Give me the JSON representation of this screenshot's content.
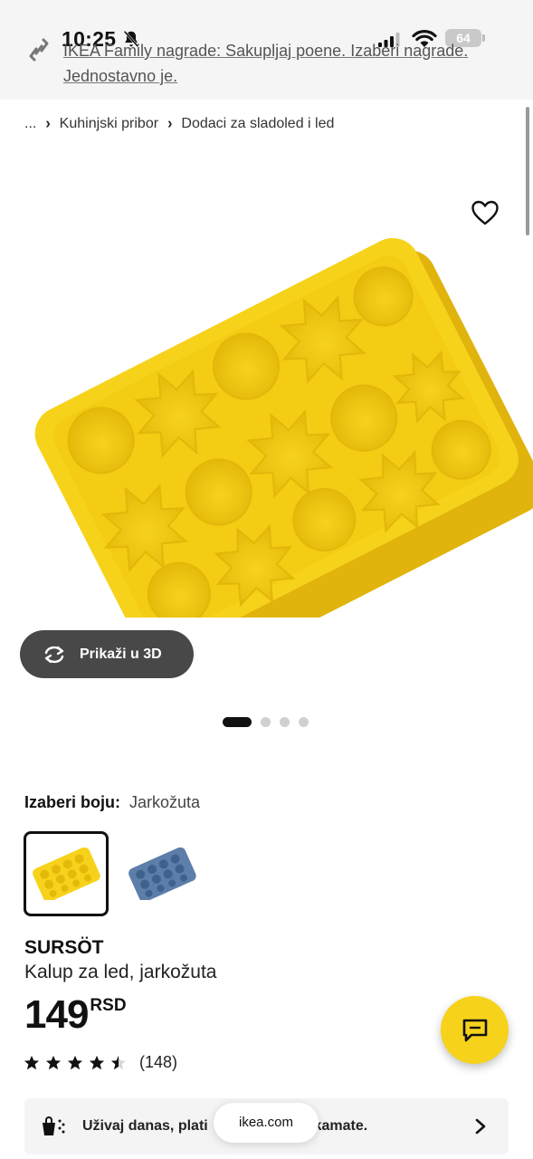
{
  "status_bar": {
    "time": "10:25",
    "battery": "64"
  },
  "promo": {
    "text": "IKEA Family nagrade: Sakupljaj poene. Izaberi nagrade. Jednostavno je."
  },
  "breadcrumb": {
    "items": [
      "...",
      "Kuhinjski pribor",
      "Dodaci za sladoled i led"
    ]
  },
  "gallery": {
    "view_3d_label": "Prikaži u 3D",
    "slide_count": 4,
    "active_slide": 1
  },
  "color": {
    "label": "Izaberi boju:",
    "value": "Jarkožuta",
    "colors": {
      "yellow": "#f6d21a",
      "blue": "#5c7ea8"
    }
  },
  "product": {
    "name": "SURSÖT",
    "description": "Kalup za led, jarkožuta",
    "price": "149",
    "currency": "RSD",
    "rating_stars": 4.5,
    "rating_count": "(148)"
  },
  "finance": {
    "text": "Uživaj danas, plati",
    "text_end": "kamate."
  },
  "browser": {
    "url": "ikea.com"
  },
  "icons": {
    "promo": "link-icon",
    "favorite": "heart-icon",
    "rotate": "rotate-3d-icon",
    "chat": "chat-icon",
    "finance": "shopping-bag-icon",
    "chevron": "chevron-right-icon"
  }
}
